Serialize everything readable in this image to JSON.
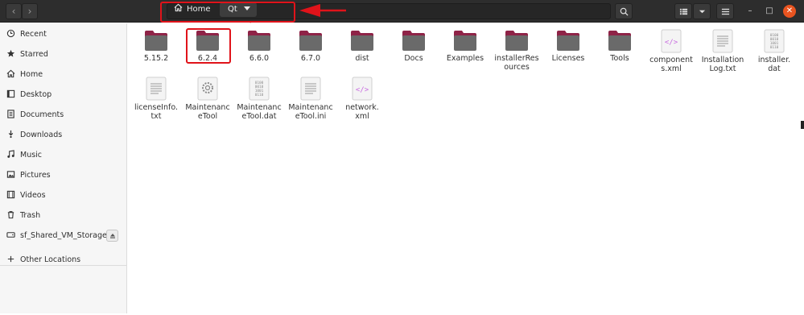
{
  "window": {
    "nav_back": "‹",
    "nav_forward": "›",
    "breadcrumbs": [
      {
        "label": "Home",
        "icon": "home-icon"
      },
      {
        "label": "Qt",
        "icon": "chevron-down-icon"
      }
    ],
    "buttons": {
      "search": "search-icon",
      "view": "list-view-icon",
      "sort": "chevron-down-icon",
      "menu": "hamburger-menu-icon",
      "minimize": "–",
      "maximize": "□",
      "close": "✕"
    }
  },
  "sidebar": {
    "items": [
      {
        "label": "Recent",
        "icon": "clock-icon"
      },
      {
        "label": "Starred",
        "icon": "star-icon"
      },
      {
        "label": "Home",
        "icon": "home-icon"
      },
      {
        "label": "Desktop",
        "icon": "desktop-icon"
      },
      {
        "label": "Documents",
        "icon": "document-icon"
      },
      {
        "label": "Downloads",
        "icon": "download-icon"
      },
      {
        "label": "Music",
        "icon": "music-icon"
      },
      {
        "label": "Pictures",
        "icon": "picture-icon"
      },
      {
        "label": "Videos",
        "icon": "video-icon"
      },
      {
        "label": "Trash",
        "icon": "trash-icon"
      },
      {
        "label": "sf_Shared_VM_Storage",
        "icon": "drive-icon"
      },
      {
        "label": "Other Locations",
        "icon": "plus-icon"
      }
    ],
    "eject_icon": "eject-icon"
  },
  "files": [
    {
      "name": "5.15.2",
      "type": "folder"
    },
    {
      "name": "6.2.4",
      "type": "folder"
    },
    {
      "name": "6.6.0",
      "type": "folder"
    },
    {
      "name": "6.7.0",
      "type": "folder"
    },
    {
      "name": "dist",
      "type": "folder"
    },
    {
      "name": "Docs",
      "type": "folder"
    },
    {
      "name": "Examples",
      "type": "folder"
    },
    {
      "name": "installerRes\nources",
      "type": "folder"
    },
    {
      "name": "Licenses",
      "type": "folder"
    },
    {
      "name": "Tools",
      "type": "folder"
    },
    {
      "name": "component\ns.xml",
      "type": "xml"
    },
    {
      "name": "Installation\nLog.txt",
      "type": "text"
    },
    {
      "name": "installer.\ndat",
      "type": "binary"
    },
    {
      "name": "licenseInfo.\ntxt",
      "type": "text"
    },
    {
      "name": "Maintenanc\neTool",
      "type": "executable"
    },
    {
      "name": "Maintenanc\neTool.dat",
      "type": "binary"
    },
    {
      "name": "Maintenanc\neTool.ini",
      "type": "text"
    },
    {
      "name": "network.\nxml",
      "type": "xml"
    }
  ],
  "colors": {
    "folder_tab": "#8f2347",
    "folder_body": "#6a6a6a",
    "xml_accent": "#c86be0",
    "highlight": "#e0131a",
    "close_button": "#e95420"
  }
}
